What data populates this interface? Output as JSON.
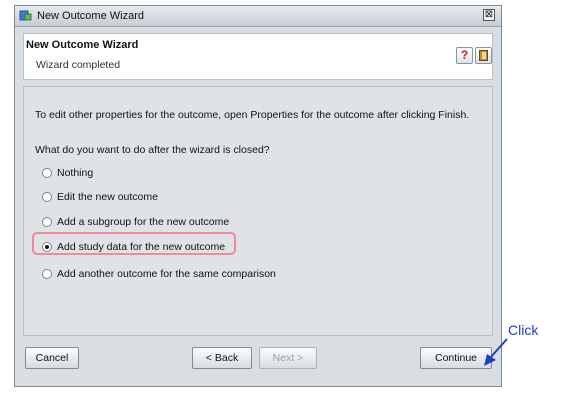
{
  "window": {
    "title": "New Outcome Wizard",
    "close_glyph": "⊠"
  },
  "header": {
    "title": "New Outcome Wizard",
    "subtitle": "Wizard completed",
    "help_glyph": "?"
  },
  "content": {
    "info": "To edit other properties for the outcome, open Properties for the outcome after clicking Finish.",
    "question": "What do you want to do after the wizard is closed?",
    "options": [
      {
        "label": "Nothing",
        "selected": false
      },
      {
        "label": "Edit the new outcome",
        "selected": false
      },
      {
        "label": "Add a subgroup for the new outcome",
        "selected": false
      },
      {
        "label": "Add study data for the new outcome",
        "selected": true
      },
      {
        "label": "Add another outcome for the same comparison",
        "selected": false
      }
    ]
  },
  "buttons": {
    "cancel": "Cancel",
    "back": "< Back",
    "next": "Next >",
    "continue": "Continue"
  },
  "annotation": {
    "click": "Click"
  },
  "colors": {
    "highlight": "#f08a9a",
    "arrow": "#1a3fc9"
  }
}
